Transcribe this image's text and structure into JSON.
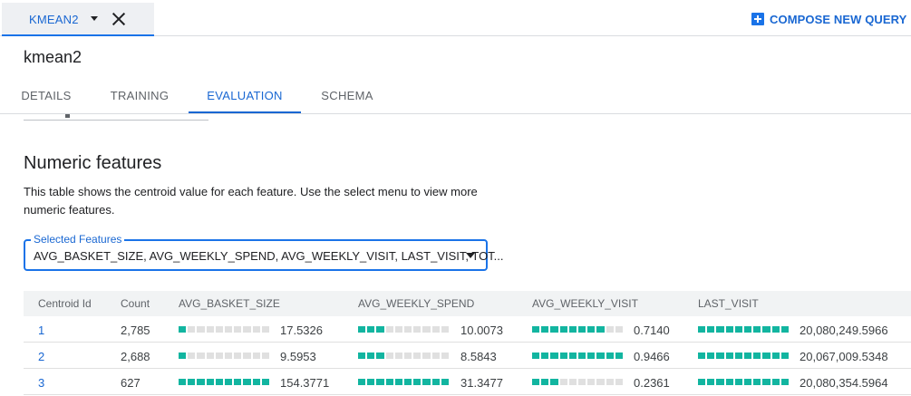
{
  "query_tab": {
    "label": "KMEAN2"
  },
  "compose": {
    "label": "COMPOSE NEW QUERY"
  },
  "model": {
    "title": "kmean2"
  },
  "tabs": [
    {
      "label": "DETAILS",
      "active": false
    },
    {
      "label": "TRAINING",
      "active": false
    },
    {
      "label": "EVALUATION",
      "active": true
    },
    {
      "label": "SCHEMA",
      "active": false
    }
  ],
  "section": {
    "title": "Numeric features",
    "description": "This table shows the centroid value for each feature. Use the select menu to view more numeric features."
  },
  "select": {
    "legend": "Selected Features",
    "value": "AVG_BASKET_SIZE, AVG_WEEKLY_SPEND, AVG_WEEKLY_VISIT, LAST_VISIT, TOT..."
  },
  "table": {
    "headers": [
      "Centroid Id",
      "Count",
      "AVG_BASKET_SIZE",
      "AVG_WEEKLY_SPEND",
      "AVG_WEEKLY_VISIT",
      "LAST_VISIT"
    ],
    "bar_color": "#12b5a0",
    "bar_track_color": "#e0e0e0",
    "rows": [
      {
        "id": "1",
        "count": "2,785",
        "features": [
          {
            "value": "17.5326",
            "fill": 0.05
          },
          {
            "value": "10.0073",
            "fill": 0.3
          },
          {
            "value": "0.7140",
            "fill": 0.75
          },
          {
            "value": "20,080,249.5966",
            "fill": 1.0
          }
        ]
      },
      {
        "id": "2",
        "count": "2,688",
        "features": [
          {
            "value": "9.5953",
            "fill": 0.05
          },
          {
            "value": "8.5843",
            "fill": 0.25
          },
          {
            "value": "0.9466",
            "fill": 1.0
          },
          {
            "value": "20,067,009.5348",
            "fill": 1.0
          }
        ]
      },
      {
        "id": "3",
        "count": "627",
        "features": [
          {
            "value": "154.3771",
            "fill": 1.0
          },
          {
            "value": "31.3477",
            "fill": 1.0
          },
          {
            "value": "0.2361",
            "fill": 0.25
          },
          {
            "value": "20,080,354.5964",
            "fill": 1.0
          }
        ]
      }
    ]
  }
}
